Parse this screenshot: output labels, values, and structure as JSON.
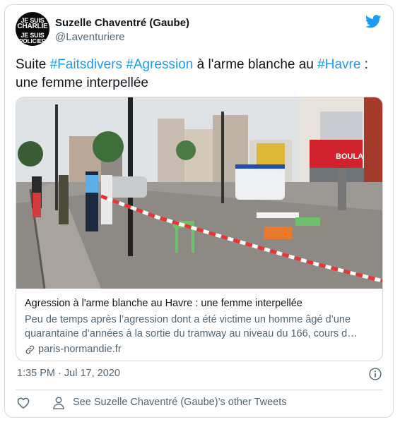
{
  "author": {
    "avatar_lines": [
      "JE SUIS",
      "CHARLIE",
      "JE SUIS",
      "POLICIER"
    ],
    "name": "Suzelle Chaventré (Gaube)",
    "handle": "@Laventuriere"
  },
  "tweet": {
    "text_prefix": "Suite ",
    "hashtag_1": "#Faitsdivers",
    "hashtag_2": "#Agression",
    "text_mid": " à l'arme blanche au ",
    "hashtag_3": "#Havre",
    "text_suffix": " : une femme interpellée"
  },
  "link_card": {
    "title": "Agression à l'arme blanche au Havre : une femme interpellée",
    "description_line1": "Peu de temps après l’agression dont a été victime un homme âgé d’une",
    "description_line2": "quarantaine d’années à la sortie du tramway au niveau du 166, cours d…",
    "domain": "paris-normandie.fr",
    "photo_sign": "BOULA"
  },
  "footer": {
    "timestamp": "1:35 PM · Jul 17, 2020",
    "other_tweets": "See Suzelle Chaventré (Gaube)’s other Tweets"
  },
  "colors": {
    "accent": "#1d9bf0",
    "text": "#0f1419",
    "muted": "#536471",
    "border": "#cfd9de"
  }
}
